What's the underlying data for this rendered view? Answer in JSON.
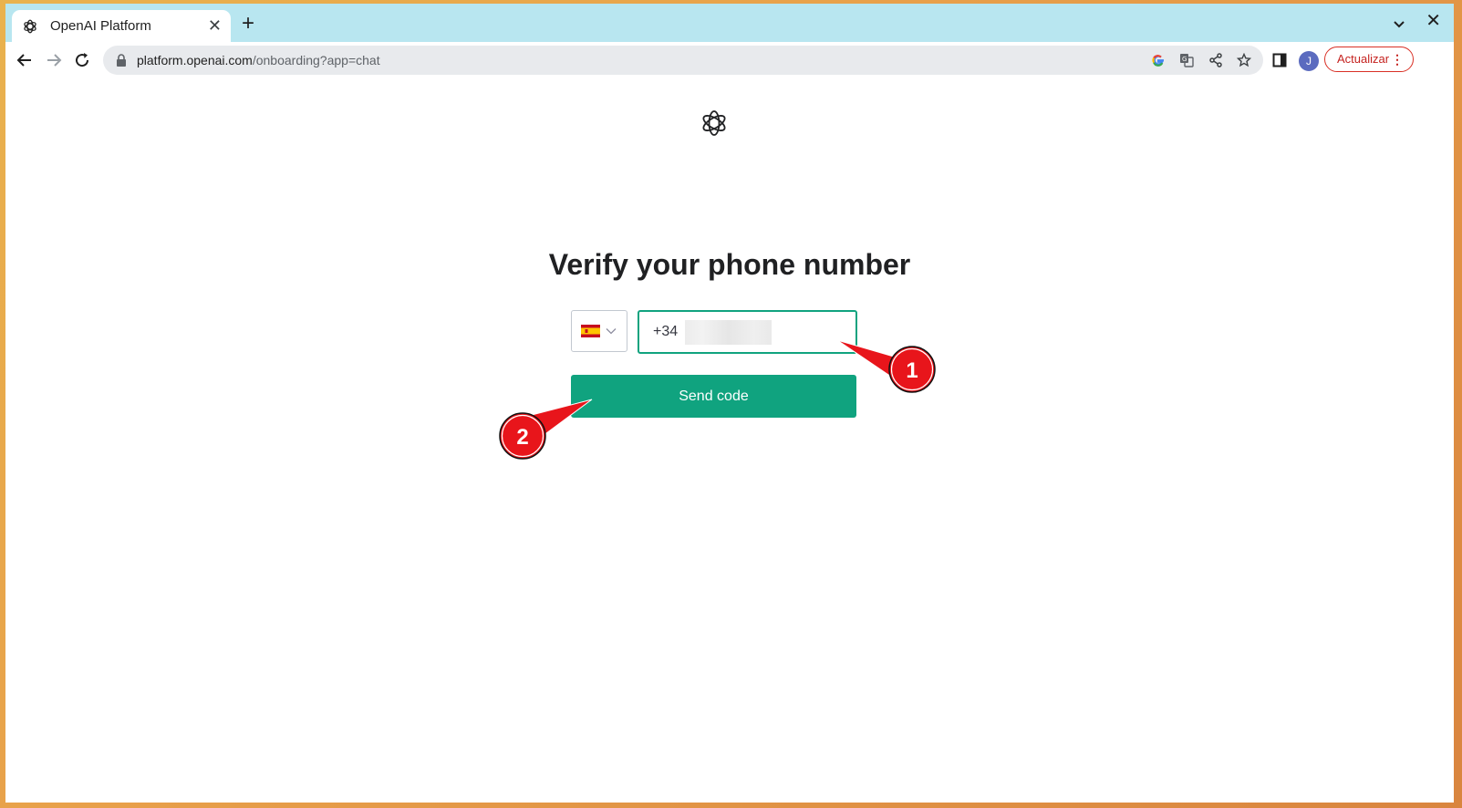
{
  "browser": {
    "tab": {
      "title": "OpenAI Platform",
      "favicon": "openai-logo-icon",
      "close_glyph": "✕"
    },
    "new_tab_glyph": "+",
    "window_close_glyph": "✕",
    "address_bar": {
      "url_host": "platform.openai.com",
      "url_path": "/onboarding?app=chat"
    },
    "profile_initial": "J",
    "update_button": {
      "label": "Actualizar",
      "menu_glyph": "⋮"
    },
    "colors": {
      "tabstrip": "#b8e6f0",
      "update_accent": "#d93025"
    }
  },
  "page": {
    "heading": "Verify your phone number",
    "country_code": "+34",
    "country_flag": "spain-flag-icon",
    "send_button_label": "Send code",
    "accent_color": "#10a37f"
  },
  "annotations": [
    {
      "label": "1",
      "target": "phone-number-input"
    },
    {
      "label": "2",
      "target": "send-code-button"
    }
  ]
}
